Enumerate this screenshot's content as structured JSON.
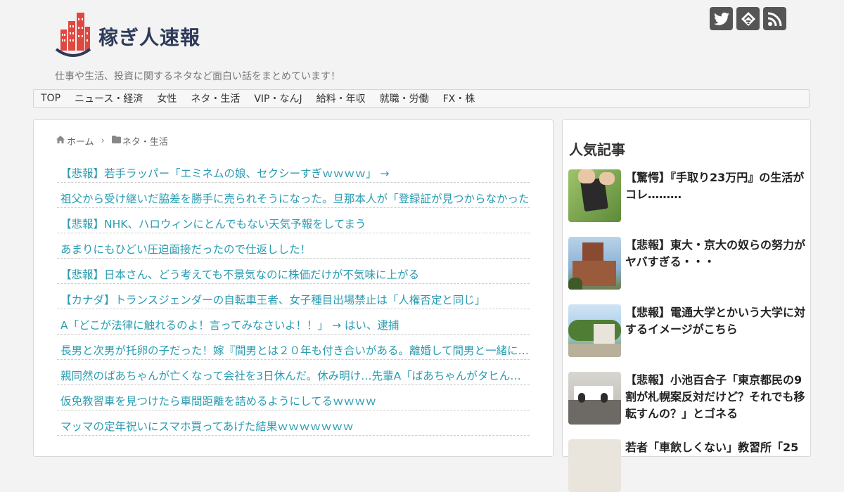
{
  "header": {
    "site_name": "稼ぎ人速報",
    "tagline": "仕事や生活、投資に関するネタなど面白い話をまとめています！",
    "social_icons": [
      "twitter-icon",
      "feedly-icon",
      "rss-icon"
    ]
  },
  "nav": {
    "items": [
      "TOP",
      "ニュース・経済",
      "女性",
      "ネタ・生活",
      "VIP・なんJ",
      "給料・年収",
      "就職・労働",
      "FX・株"
    ]
  },
  "breadcrumb": {
    "home": "ホーム",
    "category": "ネタ・生活"
  },
  "articles": [
    "【悲報】若手ラッパー「エミネムの娘、セクシーすぎｗｗｗｗ」 →",
    "祖父から受け継いだ脇差を勝手に売られそうになった。旦那本人が「登録証が見つからなかった",
    "【悲報】NHK、ハロウィンにとんでもない天気予報をしてまう",
    "あまりにもひどい圧迫面接だったので仕返しした！",
    "【悲報】日本さん、どう考えても不景気なのに株価だけが不気味に上がる",
    "【カナダ】トランスジェンダーの自転車王者、女子種目出場禁止は「人権否定と同じ」",
    "A「どこが法律に触れるのよ！言ってみなさいよ！！」 → はい、逮捕",
    "長男と次男が托卵の子だった！嫁『間男とは２０年も付き合いがある。離婚して間男と一緒になる",
    "親同然のばあちゃんが亡くなって会社を3日休んだ。休み明け…先輩A「ばあちゃんがタヒんだくらいで",
    "仮免教習車を見つけたら車間距離を詰めるようにしてるｗｗｗｗ",
    "マッマの定年祝いにスマホ買ってあげた結果ｗｗｗｗｗｗｗ"
  ],
  "sidebar": {
    "title": "人気記事",
    "popular": [
      "【驚愕】『手取り23万円』の生活がコレ………",
      "【悲報】東大・京大の奴らの努力がヤバすぎる・・・",
      "【悲報】電通大学とかいう大学に対するイメージがこちら",
      "【悲報】小池百合子「東京都民の9割が札幌案反対だけど？それでも移転すんの？」とゴネる",
      "若者「車飲しくない」教習所「25"
    ]
  },
  "colors": {
    "link": "#2a9bb0",
    "logo_text": "#2e3a5a",
    "logo_red": "#e0473f",
    "social_bg": "#555555"
  }
}
